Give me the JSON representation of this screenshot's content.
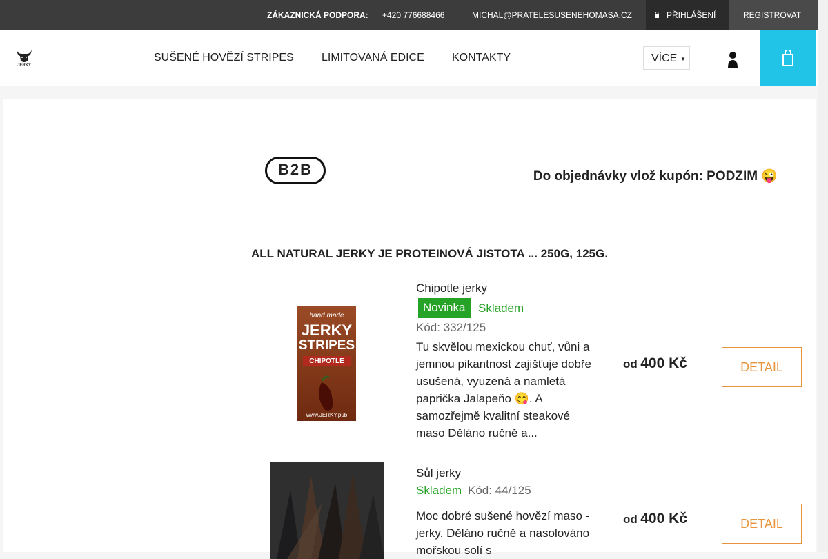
{
  "topbar": {
    "support_label": "ZÁKAZNICKÁ PODPORA:",
    "phone": "+420 776688466",
    "email": "MICHAL@PRATELESUSENEHOMASA.CZ",
    "login": "PŘIHLÁŠENÍ",
    "register": "REGISTROVAT",
    "login_icon": "login-icon"
  },
  "nav": {
    "logo_text": "JERKY",
    "items": [
      "SUŠENÉ HOVĚZÍ STRIPES",
      "LIMITOVANÁ EDICE",
      "KONTAKTY"
    ],
    "more": "VÍCE",
    "account_icon": "user-icon",
    "cart_icon": "cart-icon"
  },
  "banner": {
    "b2b": "B2B",
    "coupon": "Do objednávky vlož kupón: PODZIM 😜"
  },
  "category": {
    "heading": "ALL NATURAL JERKY JE PROTEINOVÁ JISTOTA ... 250G, 125G."
  },
  "products": [
    {
      "name": "Chipotle jerky",
      "badge": "Novinka",
      "stock": "Skladem",
      "code": "Kód: 332/125",
      "desc": "Tu skvělou mexickou chuť, vůni a jemnou pikantnost zajišťuje dobře usušená, vyuzená a namletá paprička Jalapeňo 😋. A samozřejmě kvalitní steakové maso  Děláno ručně a...",
      "price_from": "od",
      "price": "400 Kč",
      "detail": "DETAIL",
      "image_text": {
        "line1": "hand made",
        "line2": "JERKY",
        "line3": "STRIPES",
        "line4": "CHIPOTLE",
        "line5": "www.JERKY.pub"
      }
    },
    {
      "name": "Sůl jerky",
      "stock": "Skladem",
      "code": "Kód: 44/125",
      "desc": "Moc dobré sušené hovězí maso - jerky. Děláno ručně a nasolováno mořskou solí s",
      "price_from": "od",
      "price": "400 Kč",
      "detail": "DETAIL"
    }
  ],
  "colors": {
    "topbar": "#3c3c3c",
    "accent_cart": "#21c3e6",
    "stock_green": "#26a326",
    "detail_orange": "#e8943a"
  }
}
